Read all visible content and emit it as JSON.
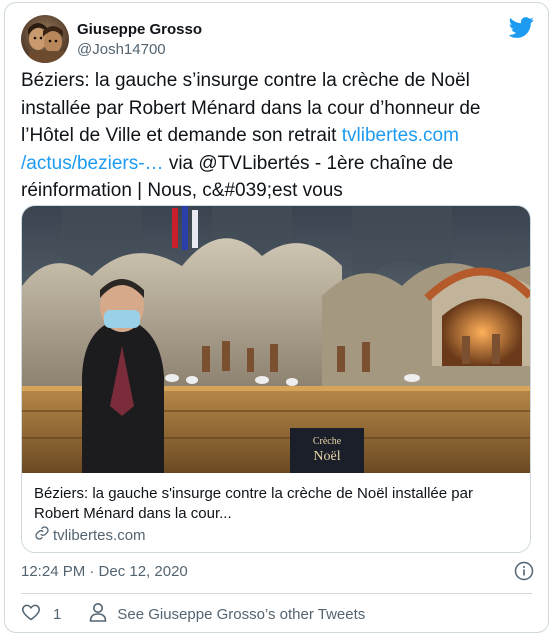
{
  "author": {
    "name": "Giuseppe Grosso",
    "handle": "@Josh14700"
  },
  "tweet": {
    "text_part1": "Béziers: la gauche s’insurge contre la crèche de Noël installée par Robert Ménard dans la cour d’honneur de l’Hôtel de Ville et demande son retrait ",
    "link_text": "tvlibertes.com /actus/beziers-…",
    "text_part2": " via @TVLibertés - 1ère chaîne de réinformation | Nous, c&#039;est vous"
  },
  "card": {
    "image_caption": "Crèche de Noël",
    "title": "Béziers: la gauche s'insurge contre la crèche de Noël installée par Robert Ménard dans la cour...",
    "domain": "tvlibertes.com"
  },
  "meta": {
    "timestamp": "12:24 PM · Dec 12, 2020"
  },
  "actions": {
    "like_count": "1",
    "see_more_label": "See Giuseppe Grosso’s other Tweets"
  },
  "colors": {
    "accent": "#1d9bf0",
    "text": "#0f1419",
    "muted": "#536471",
    "border": "#cfd9de"
  },
  "icons": [
    "avatar",
    "twitter-bird-icon",
    "link-icon",
    "info-icon",
    "heart-icon",
    "person-icon"
  ]
}
